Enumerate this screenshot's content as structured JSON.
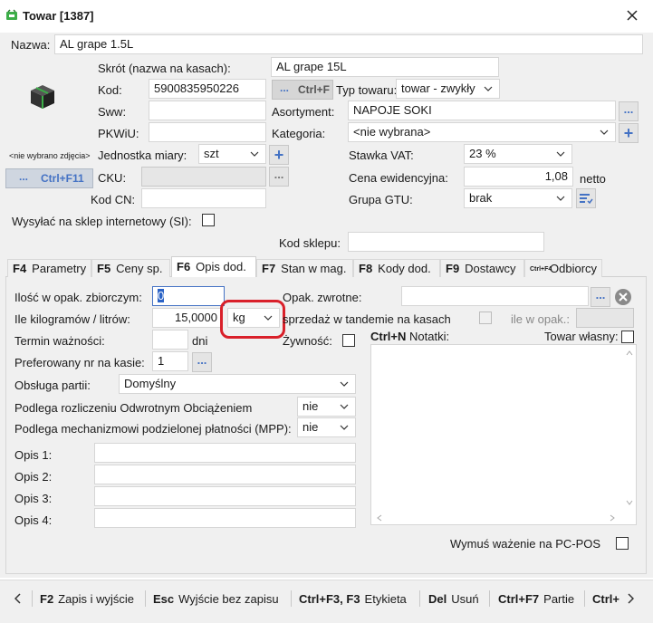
{
  "window": {
    "title": "Towar [1387]"
  },
  "header": {
    "nazwa_label": "Nazwa:",
    "nazwa_value": "AL grape 1.5L",
    "skrot_label": "Skrót (nazwa na kasach):",
    "skrot_value": "AL grape 15L",
    "kod_label": "Kod:",
    "kod_value": "5900835950226",
    "ctrlf_label": "Ctrl+F",
    "typ_label": "Typ towaru:",
    "typ_value": "towar - zwykły",
    "sww_label": "Sww:",
    "sww_value": "",
    "asortyment_label": "Asortyment:",
    "asortyment_value": "NAPOJE SOKI",
    "pkwiu_label": "PKWiU:",
    "pkwiu_value": "",
    "kategoria_label": "Kategoria:",
    "kategoria_value": "<nie wybrana>",
    "no_photo_label": "<nie wybrano zdjęcia>",
    "photo_btn_label": "Ctrl+F11",
    "jm_label": "Jednostka miary:",
    "jm_value": "szt",
    "vat_label": "Stawka VAT:",
    "vat_value": "23 %",
    "cku_label": "CKU:",
    "cku_value": "",
    "cena_label": "Cena ewidencyjna:",
    "cena_value": "1,08",
    "netto_label": "netto",
    "kodcn_label": "Kod CN:",
    "kodcn_value": "",
    "gtu_label": "Grupa GTU:",
    "gtu_value": "brak",
    "wysylac_label": "Wysyłać na sklep internetowy (SI):",
    "kod_sklepu_label": "Kod sklepu:",
    "kod_sklepu_value": ""
  },
  "tabs": [
    {
      "key": "F4",
      "label": "Parametry"
    },
    {
      "key": "F5",
      "label": "Ceny sp."
    },
    {
      "key": "F6",
      "label": "Opis dod."
    },
    {
      "key": "F7",
      "label": "Stan w mag."
    },
    {
      "key": "F8",
      "label": "Kody dod."
    },
    {
      "key": "F9",
      "label": "Dostawcy"
    },
    {
      "key": "Ctrl+F4",
      "label": "Odbiorcy"
    }
  ],
  "tabpanel": {
    "ilosc_label": "Ilość w opak. zbiorczym:",
    "ilosc_value": "0",
    "kg_label": "Ile kilogramów / litrów:",
    "kg_value": "15,0000",
    "kg_unit": "kg",
    "termin_label": "Termin ważności:",
    "termin_value": "",
    "dni_label": "dni",
    "pref_label": "Preferowany nr na kasie:",
    "pref_value": "1",
    "partii_label": "Obsługa partii:",
    "partii_value": "Domyślny",
    "odwr_label": "Podlega rozliczeniu Odwrotnym Obciążeniem",
    "odwr_value": "nie",
    "mpp_label": "Podlega mechanizmowi podzielonej płatności (MPP):",
    "mpp_value": "nie",
    "opis1_label": "Opis 1:",
    "opis2_label": "Opis 2:",
    "opis3_label": "Opis 3:",
    "opis4_label": "Opis 4:",
    "opak_label": "Opak. zwrotne:",
    "opak_value": "",
    "tandem_label": "sprzedaż w tandemie na kasach",
    "ile_label": "ile w opak.:",
    "ile_value": "",
    "zywnosc_label": "Żywność:",
    "notatki_key": "Ctrl+N",
    "notatki_label": "Notatki:",
    "notatki_value": "",
    "wlasny_label": "Towar własny:",
    "wazenie_label": "Wymuś ważenie na PC-POS"
  },
  "bottombar": [
    {
      "key": "F2",
      "label": "Zapis i wyjście"
    },
    {
      "key": "Esc",
      "label": "Wyjście bez zapisu"
    },
    {
      "key": "Ctrl+F3, F3",
      "label": "Etykieta"
    },
    {
      "key": "Del",
      "label": "Usuń"
    },
    {
      "key": "Ctrl+F7",
      "label": "Partie"
    },
    {
      "key": "Ctrl+",
      "label": ""
    }
  ],
  "colors": {
    "accent": "#4472c4",
    "highlight": "#d9202a",
    "title_bg": "#ffffff",
    "panel_bg": "#f0f0f0"
  }
}
